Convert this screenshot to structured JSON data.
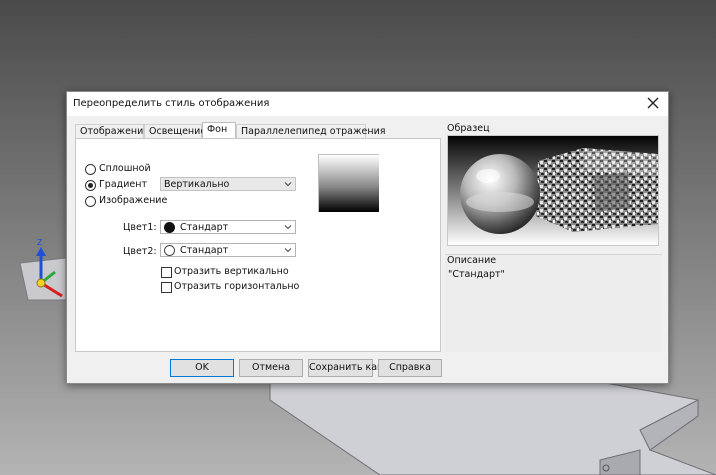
{
  "dialog": {
    "title": "Переопределить стиль отображения",
    "tabs": [
      {
        "label": "Отображение",
        "active": false
      },
      {
        "label": "Освещение",
        "active": false
      },
      {
        "label": "Фон",
        "active": true
      },
      {
        "label": "Параллелепипед отражения",
        "active": false
      }
    ],
    "background": {
      "options": [
        {
          "label": "Сплошной",
          "selected": false
        },
        {
          "label": "Градиент",
          "selected": true
        },
        {
          "label": "Изображение",
          "selected": false
        }
      ],
      "gradient_direction": "Вертикально",
      "color1_label": "Цвет1:",
      "color1_value": "Стандарт",
      "color1_swatch": "#111111",
      "color2_label": "Цвет2:",
      "color2_value": "Стандарт",
      "color2_swatch": "#ffffff",
      "flip_vertical": "Отразить вертикально",
      "flip_horizontal": "Отразить горизонтально"
    },
    "sample_label": "Образец",
    "description_label": "Описание",
    "description_value": "\"Стандарт\"",
    "buttons": {
      "ok": "OK",
      "cancel": "Отмена",
      "save_as": "Сохранить как",
      "help": "Справка"
    }
  },
  "viewport": {
    "axis_label": "Z"
  }
}
